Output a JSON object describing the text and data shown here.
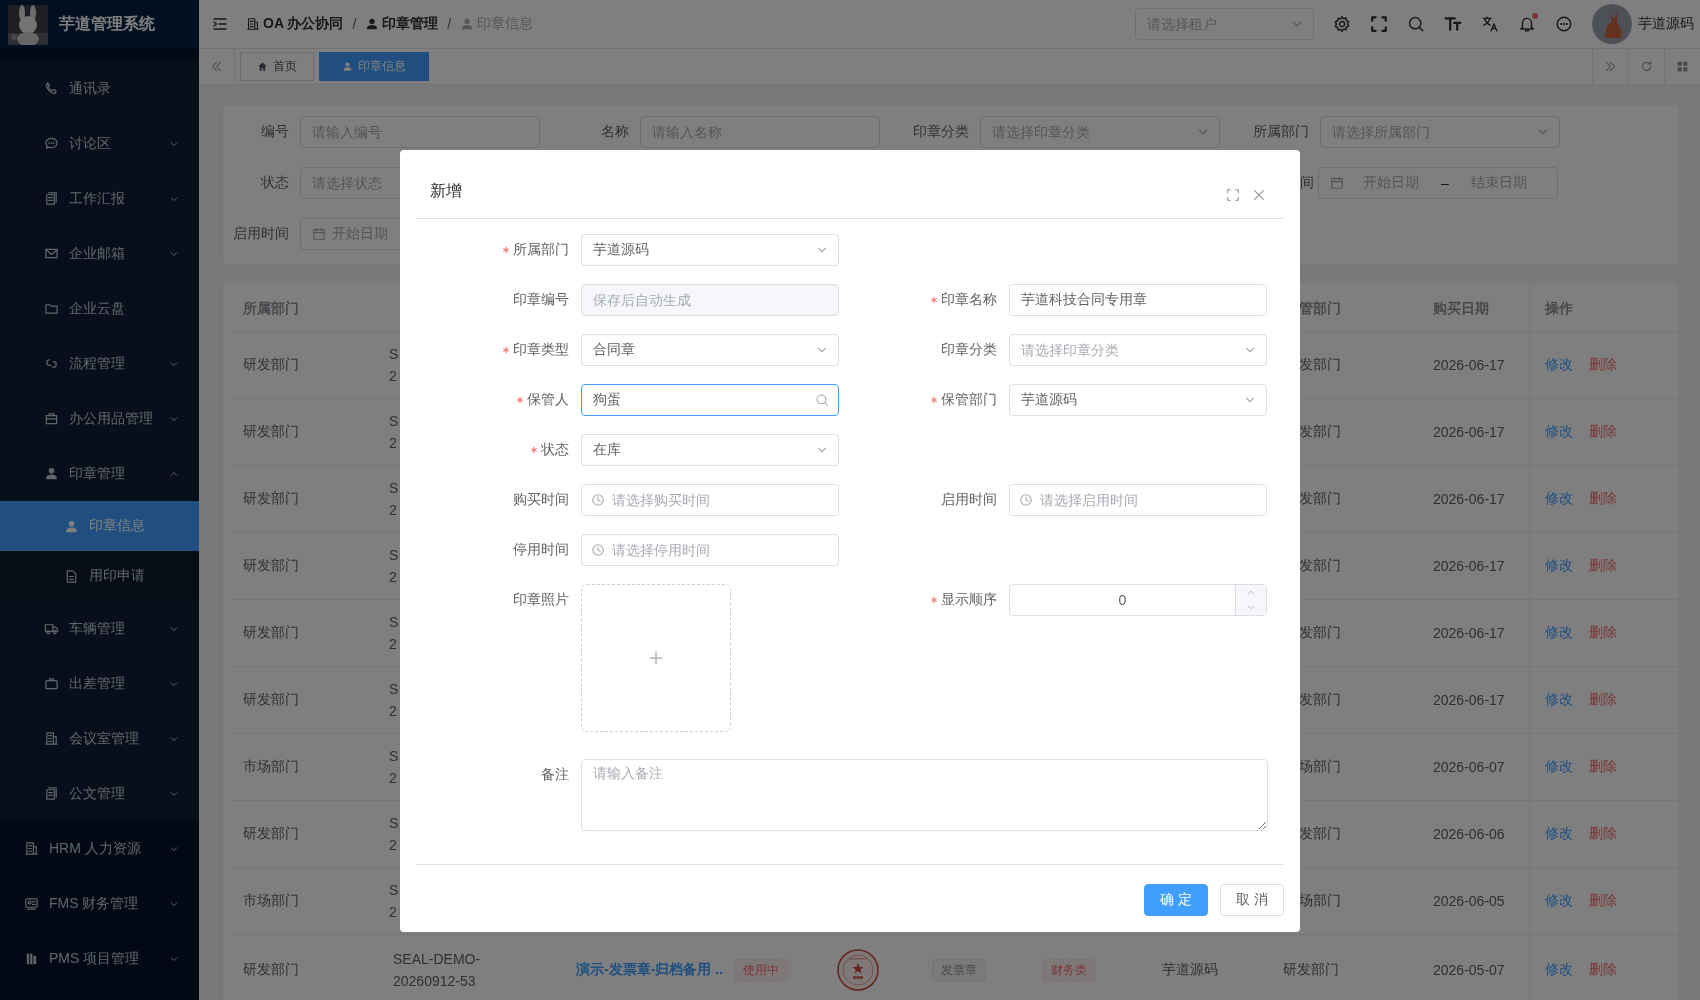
{
  "sidebar": {
    "title": "芋道管理系统",
    "group_items": [
      {
        "label": "通讯录",
        "kind": "link"
      },
      {
        "label": "讨论区",
        "kind": "submenu",
        "expanded": false
      },
      {
        "label": "工作汇报",
        "kind": "submenu",
        "expanded": false
      },
      {
        "label": "企业邮箱",
        "kind": "submenu",
        "expanded": false
      },
      {
        "label": "企业云盘",
        "kind": "link"
      },
      {
        "label": "流程管理",
        "kind": "submenu",
        "expanded": false
      },
      {
        "label": "办公用品管理",
        "kind": "submenu",
        "expanded": false
      },
      {
        "label": "印章管理",
        "kind": "submenu",
        "expanded": true,
        "children": [
          {
            "label": "印章信息",
            "selected": true
          },
          {
            "label": "用印申请",
            "selected": false
          }
        ]
      },
      {
        "label": "车辆管理",
        "kind": "submenu",
        "expanded": false
      },
      {
        "label": "出差管理",
        "kind": "submenu",
        "expanded": false
      },
      {
        "label": "会议室管理",
        "kind": "submenu",
        "expanded": false
      },
      {
        "label": "公文管理",
        "kind": "submenu",
        "expanded": false
      }
    ],
    "items": [
      {
        "label": "HRM 人力资源",
        "kind": "submenu",
        "expanded": false
      },
      {
        "label": "FMS 财务管理",
        "kind": "submenu",
        "expanded": false
      },
      {
        "label": "PMS 项目管理",
        "kind": "submenu",
        "expanded": false
      }
    ]
  },
  "breadcrumb": {
    "separator": "/",
    "items": [
      {
        "label": "OA 办公协同",
        "current": false
      },
      {
        "label": "印章管理",
        "current": false
      },
      {
        "label": "印章信息",
        "current": true
      }
    ]
  },
  "header": {
    "tenant_select": {
      "placeholder": "请选择租户"
    },
    "notification_dot": true,
    "user_name": "芋道源码"
  },
  "tabs": [
    {
      "label": "首页",
      "selected": false
    },
    {
      "label": "印章信息",
      "selected": true
    }
  ],
  "filter_rows": [
    {
      "left": [
        {
          "label": "编号",
          "kind": "input",
          "placeholder": "请输入编号"
        },
        {
          "label": "名称",
          "kind": "input",
          "placeholder": "请输入名称"
        },
        {
          "label": "印章分类",
          "kind": "select",
          "placeholder": "请选择印章分类"
        },
        {
          "label": "所属部门",
          "kind": "select",
          "placeholder": "请选择所属部门"
        }
      ]
    },
    {
      "left": [
        {
          "label": "状态",
          "kind": "input",
          "placeholder": "请选择状态"
        }
      ],
      "right": [
        {
          "label": "间",
          "kind": "daterange",
          "start": "开始日期",
          "separator": "–",
          "end": "结束日期"
        }
      ]
    },
    {
      "left": [
        {
          "label": "启用时间",
          "kind": "daterange",
          "start": "开始日期"
        }
      ]
    }
  ],
  "table": {
    "columns": [
      {
        "label": "所属部门",
        "kind": "dept"
      },
      {
        "label": "管部门",
        "kind": "keeper_dept"
      },
      {
        "label": "购买日期",
        "kind": "purchase_date"
      },
      {
        "label": "操作",
        "kind": "actions"
      }
    ],
    "rows": [
      {
        "kind": "partial",
        "dept": "研发部门",
        "code": "S 2",
        "keeper_dept": "发部门",
        "purchase_date": "2026-06-17",
        "actions": [
          {
            "label": "修改",
            "kind": "edit"
          },
          {
            "label": "删除",
            "kind": "delete"
          }
        ]
      },
      {
        "kind": "partial",
        "dept": "研发部门",
        "code": "S 2",
        "keeper_dept": "发部门",
        "purchase_date": "2026-06-17",
        "actions": [
          {
            "label": "修改",
            "kind": "edit"
          },
          {
            "label": "删除",
            "kind": "delete"
          }
        ]
      },
      {
        "kind": "partial",
        "dept": "研发部门",
        "code": "S 2",
        "keeper_dept": "发部门",
        "purchase_date": "2026-06-17",
        "actions": [
          {
            "label": "修改",
            "kind": "edit"
          },
          {
            "label": "删除",
            "kind": "delete"
          }
        ]
      },
      {
        "kind": "partial",
        "dept": "研发部门",
        "code": "S 2",
        "keeper_dept": "发部门",
        "purchase_date": "2026-06-17",
        "actions": [
          {
            "label": "修改",
            "kind": "edit"
          },
          {
            "label": "删除",
            "kind": "delete"
          }
        ]
      },
      {
        "kind": "partial",
        "dept": "研发部门",
        "code": "S 2",
        "keeper_dept": "发部门",
        "purchase_date": "2026-06-17",
        "actions": [
          {
            "label": "修改",
            "kind": "edit"
          },
          {
            "label": "删除",
            "kind": "delete"
          }
        ]
      },
      {
        "kind": "partial",
        "dept": "研发部门",
        "code": "S 2",
        "keeper_dept": "发部门",
        "purchase_date": "2026-06-17",
        "actions": [
          {
            "label": "修改",
            "kind": "edit"
          },
          {
            "label": "删除",
            "kind": "delete"
          }
        ]
      },
      {
        "kind": "partial",
        "dept": "市场部门",
        "code": "S 2",
        "keeper_dept": "场部门",
        "purchase_date": "2026-06-07",
        "actions": [
          {
            "label": "修改",
            "kind": "edit"
          },
          {
            "label": "删除",
            "kind": "delete"
          }
        ]
      },
      {
        "kind": "partial",
        "dept": "研发部门",
        "code": "S 2",
        "keeper_dept": "发部门",
        "purchase_date": "2026-06-06",
        "actions": [
          {
            "label": "修改",
            "kind": "edit"
          },
          {
            "label": "删除",
            "kind": "delete"
          }
        ]
      },
      {
        "kind": "partial",
        "dept": "市场部门",
        "code": "S 2",
        "keeper_dept": "场部门",
        "purchase_date": "2026-06-05",
        "actions": [
          {
            "label": "修改",
            "kind": "edit"
          },
          {
            "label": "删除",
            "kind": "delete"
          }
        ]
      },
      {
        "kind": "full",
        "dept": "研发部门",
        "code": "SEAL-DEMO-20260912-53",
        "name": "演示-发票章-归档备用 ..",
        "status": {
          "label": "使用中",
          "kind": "danger"
        },
        "photo": {
          "kind": "picture"
        },
        "seal_type": {
          "label": "发票章",
          "kind": "info"
        },
        "category": {
          "label": "财务类",
          "kind": "danger"
        },
        "keeper": "芋道源码",
        "keeper_dept": "研发部门",
        "purchase_date": "2026-05-07",
        "actions": [
          {
            "label": "修改",
            "kind": "edit"
          },
          {
            "label": "删除",
            "kind": "delete"
          }
        ]
      }
    ]
  },
  "dialog": {
    "title": "新增",
    "form_rows": [
      {
        "left": {
          "label": "所属部门",
          "kind": "select",
          "value": "芋道源码",
          "required": true
        }
      },
      {
        "left": {
          "label": "印章编号",
          "kind": "disabled",
          "placeholder": "保存后自动生成",
          "required": false
        },
        "right": {
          "label": "印章名称",
          "kind": "input",
          "value": "芋道科技合同专用章",
          "required": true
        }
      },
      {
        "left": {
          "label": "印章类型",
          "kind": "select",
          "value": "合同章",
          "required": true
        },
        "right": {
          "label": "印章分类",
          "kind": "select",
          "placeholder": "请选择印章分类",
          "required": false
        }
      },
      {
        "left": {
          "label": "保管人",
          "kind": "search",
          "value": "狗蛋",
          "required": true,
          "focused": true
        },
        "right": {
          "label": "保管部门",
          "kind": "select",
          "value": "芋道源码",
          "required": true
        }
      },
      {
        "left": {
          "label": "状态",
          "kind": "select",
          "value": "在库",
          "required": true
        }
      },
      {
        "left": {
          "label": "购买时间",
          "kind": "date",
          "placeholder": "请选择购买时间",
          "required": false
        },
        "right": {
          "label": "启用时间",
          "kind": "date",
          "placeholder": "请选择启用时间",
          "required": false
        }
      },
      {
        "left": {
          "label": "停用时间",
          "kind": "date",
          "placeholder": "请选择停用时间",
          "required": false
        }
      },
      {
        "left": {
          "label": "印章照片",
          "kind": "upload",
          "required": false
        },
        "right": {
          "label": "显示顺序",
          "kind": "number",
          "value": "0",
          "required": true
        }
      }
    ],
    "remark": {
      "label": "备注",
      "placeholder": "请输入备注"
    },
    "buttons": [
      {
        "label": "确 定",
        "kind": "primary"
      },
      {
        "label": "取 消",
        "kind": "default"
      }
    ]
  }
}
